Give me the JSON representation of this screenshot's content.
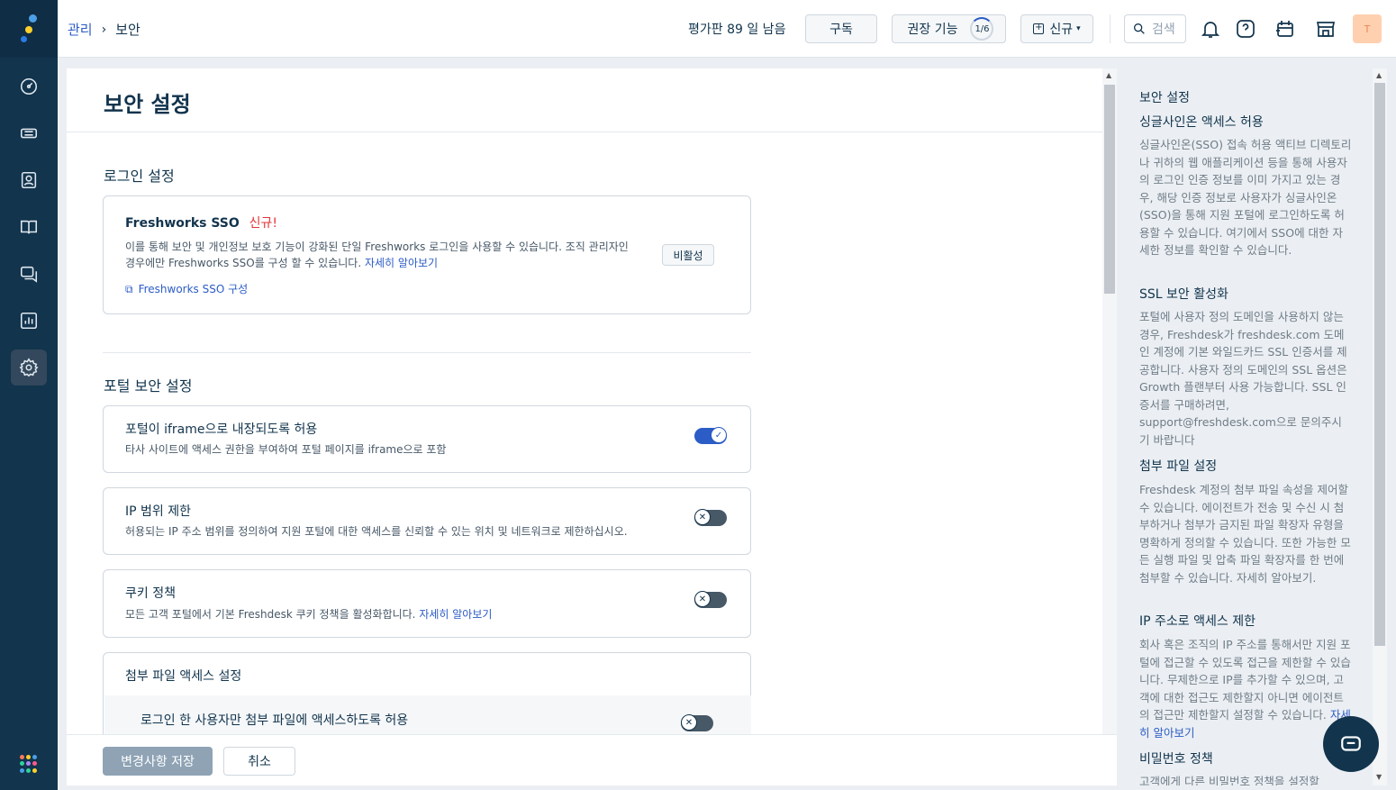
{
  "breadcrumb": {
    "parent": "관리",
    "separator": "›",
    "current": "보안"
  },
  "topbar": {
    "trial": "평가판 89 일 남음",
    "subscribe": "구독",
    "recommended": "권장 기능",
    "progress": "1/6",
    "new": "신규",
    "search": "검색",
    "avatar": "T"
  },
  "page": {
    "title": "보안 설정"
  },
  "login": {
    "heading": "로그인 설정",
    "sso_title": "Freshworks SSO",
    "sso_badge": "신규!",
    "sso_desc1": "이를 통해 보안 및 개인정보 보호 기능이 강화된 단일 Freshworks 로그인을 사용할 수 있습니다. 조직 관리자인",
    "sso_desc2": "경우에만 Freshworks SSO를 구성 할 수 있습니다.",
    "learn_more": "자세히 알아보기",
    "deactivate": "비활성",
    "configure": "Freshworks SSO 구성"
  },
  "portal": {
    "heading": "포털 보안 설정",
    "items": [
      {
        "title": "포털이 iframe으로 내장되도록 허용",
        "desc": "타사 사이트에 액세스 권한을 부여하여 포털 페이지를 iframe으로 포함",
        "enabled": true
      },
      {
        "title": "IP 범위 제한",
        "desc": "허용되는 IP 주소 범위를 정의하여 지원 포털에 대한 액세스를 신뢰할 수 있는 위치 및 네트워크로 제한하십시오.",
        "enabled": false
      },
      {
        "title": "쿠키 정책",
        "desc": "모든 고객 포털에서 기본 Freshdesk 쿠키 정책을 활성화합니다.",
        "link": "자세히 알아보기",
        "enabled": false
      }
    ],
    "attach_title": "첨부 파일 액세스 설정",
    "attach_sub": "로그인 한 사용자만 첨부 파일에 액세스하도록 허용",
    "attach_enabled": false
  },
  "footer": {
    "save": "변경사항 저장",
    "cancel": "취소"
  },
  "sidebar": {
    "title": "보안 설정",
    "sections": [
      {
        "h": "싱글사인온 액세스 허용",
        "p": "싱글사인온(SSO) 접속 허용 액티브 디렉토리나 귀하의 웹 애플리케이션 등을 통해 사용자의 로그인 인증 정보를 이미 가지고 있는 경우, 해당 인증 정보로 사용자가 싱글사인온(SSO)을 통해 지원 포털에 로그인하도록 허용할 수 있습니다. 여기에서 SSO에 대한 자세한 정보를 확인할 수 있습니다."
      },
      {
        "h": "SSL 보안 활성화",
        "p": "포털에 사용자 정의 도메인을 사용하지 않는 경우, Freshdesk가 freshdesk.com 도메인 계정에 기본 와일드카드 SSL 인증서를 제공합니다. 사용자 정의 도메인의 SSL 옵션은 Growth 플랜부터 사용 가능합니다. SSL 인증서를 구매하려면, support@freshdesk.com으로 문의주시기 바랍니다"
      },
      {
        "h": "첨부 파일 설정",
        "p": "Freshdesk 계정의 첨부 파일 속성을 제어할 수 있습니다. 에이전트가 전송 및 수신 시 첨부하거나 첨부가 금지된 파일 확장자 유형을 명확하게 정의할 수 있습니다. 또한 가능한 모든 실행 파일 및 압축 파일 확장자를 한 번에 첨부할 수 있습니다. 자세히 알아보기."
      },
      {
        "h": "IP 주소로 액세스 제한",
        "p": "회사 혹은 조직의 IP 주소를 통해서만 지원 포털에 접근할 수 있도록 접근을 제한할 수 있습니다. 무제한으로 IP를 추가할 수 있으며, 고객에 대한 접근도 제한할지 아니면 에이전트의 접근만 제한할지 설정할 수 있습니다.",
        "link": "자세히 알아보기"
      },
      {
        "h": "비밀번호 정책",
        "p": "고객에게 다른 비밀번호 정책을 설정할"
      }
    ]
  },
  "colors": {
    "rail": "#12344d",
    "accent": "#2c5cc5",
    "badge": "#e43538"
  }
}
